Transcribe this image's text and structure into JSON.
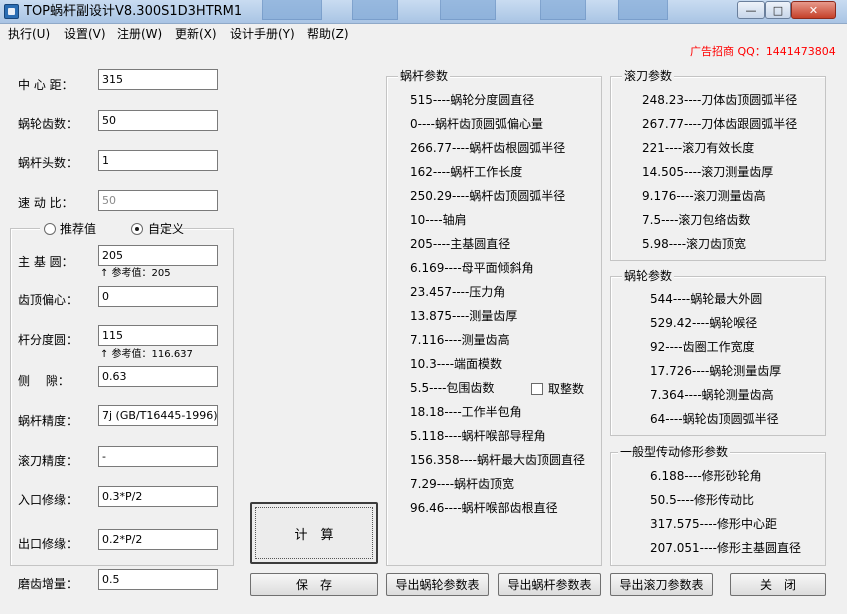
{
  "window": {
    "title": "TOP蜗杆副设计V8.300S1D3HTRM1",
    "minimize_glyph": "—",
    "maximize_glyph": "□",
    "close_glyph": "✕"
  },
  "menu": [
    "执行(U)",
    "设置(V)",
    "注册(W)",
    "更新(X)",
    "设计手册(Y)",
    "帮助(Z)"
  ],
  "ad": "广告招商 QQ：1441473804",
  "inputs": {
    "center_distance": {
      "label": "中 心 距：",
      "value": "315"
    },
    "worm_wheel_teeth": {
      "label": "蜗轮齿数：",
      "value": "50"
    },
    "worm_starts": {
      "label": "蜗杆头数：",
      "value": "1"
    },
    "speed_ratio": {
      "label": "速 动 比：",
      "value": "50"
    }
  },
  "mode": {
    "recommended": "推荐值",
    "custom": "自定义",
    "selected": "custom"
  },
  "custom_fields": {
    "base_circle": {
      "label": "主 基 圆：",
      "value": "205",
      "hint": "↑ 参考值：205"
    },
    "tip_offset": {
      "label": "齿顶偏心：",
      "value": "0"
    },
    "pitch_circle": {
      "label": "杆分度圆：",
      "value": "115",
      "hint": "↑ 参考值：116.637"
    },
    "flank_gap": {
      "label": "侧　 隙：",
      "value": "0.63"
    }
  },
  "precision": {
    "worm_precision": {
      "label": "蜗杆精度：",
      "value": "7j (GB/T16445-1996)"
    },
    "hob_precision": {
      "label": "滚刀精度：",
      "value": "-"
    },
    "entry_mod": {
      "label": "入口修缘：",
      "value": "0.3*P/2"
    },
    "exit_mod": {
      "label": "出口修缘：",
      "value": "0.2*P/2"
    },
    "grind_allowance": {
      "label": "磨齿增量：",
      "value": "0.5"
    }
  },
  "worm_params": {
    "title": "蜗杆参数",
    "rows": [
      "515----蜗轮分度圆直径",
      "0----蜗杆齿顶圆弧偏心量",
      "266.77----蜗杆齿根圆弧半径",
      "162----蜗杆工作长度",
      "250.29----蜗杆齿顶圆弧半径",
      "10----轴肩",
      "205----主基圆直径",
      "6.169----母平面倾斜角",
      "23.457----压力角",
      "13.875----测量齿厚",
      "7.116----测量齿高",
      "10.3----端面模数",
      "5.5----包围齿数",
      "18.18----工作半包角",
      "5.118----蜗杆喉部导程角",
      "156.358----蜗杆最大齿顶圆直径",
      "7.29----蜗杆齿顶宽",
      "96.46----蜗杆喉部齿根直径"
    ],
    "round_teeth_label": "取整数"
  },
  "hob_params": {
    "title": "滚刀参数",
    "rows": [
      "248.23----刀体齿顶圆弧半径",
      "267.77----刀体齿跟圆弧半径",
      "221----滚刀有效长度",
      "14.505----滚刀测量齿厚",
      "9.176----滚刀测量齿高",
      "7.5----滚刀包络齿数",
      "5.98----滚刀齿顶宽"
    ]
  },
  "wheel_params": {
    "title": "蜗轮参数",
    "rows": [
      "544----蜗轮最大外圆",
      "529.42----蜗轮喉径",
      "92----齿圈工作宽度",
      "17.726----蜗轮测量齿厚",
      "7.364----蜗轮测量齿高",
      "64----蜗轮齿顶圆弧半径"
    ]
  },
  "general_params": {
    "title": "一般型传动修形参数",
    "rows": [
      "6.188----修形砂轮角",
      "50.5----修形传动比",
      "317.575----修形中心距",
      "207.051----修形主基圆直径"
    ]
  },
  "buttons": {
    "calculate": "计　算",
    "save": "保　存",
    "export_wheel": "导出蜗轮参数表",
    "export_worm": "导出蜗杆参数表",
    "export_hob": "导出滚刀参数表",
    "close": "关　闭"
  }
}
